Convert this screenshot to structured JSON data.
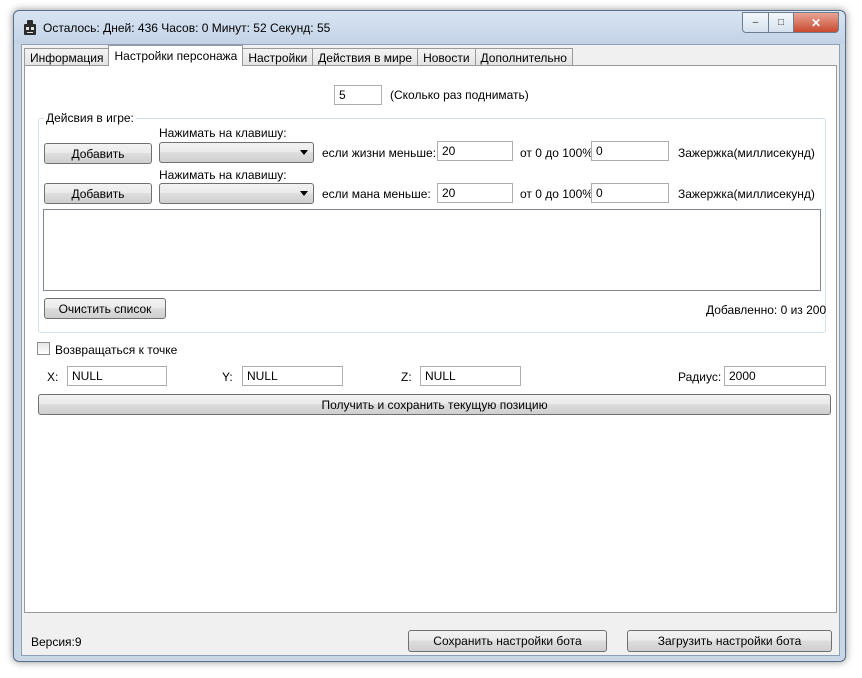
{
  "window": {
    "title": "Осталось: Дней: 436 Часов: 0 Минут: 52 Секунд: 55",
    "close_glyph": "✕",
    "max_glyph": "□",
    "min_glyph": "–"
  },
  "tabs": [
    {
      "label": "Информация"
    },
    {
      "label": "Настройки персонажа"
    },
    {
      "label": "Настройки"
    },
    {
      "label": "Действия в мире"
    },
    {
      "label": "Новости"
    },
    {
      "label": "Дополнительно"
    }
  ],
  "pickup": {
    "count_value": "5",
    "count_hint": "(Сколько раз поднимать)"
  },
  "actions_group": {
    "title": "Дейсвия в игре:",
    "rows": [
      {
        "add_label": "Добавить",
        "key_label": "Нажимать на клавишу:",
        "key_value": "",
        "condition_label": "если жизни меньше:",
        "threshold_value": "20",
        "range_label": "от 0 до 100%",
        "delay_value": "0",
        "delay_label": "Зажержка(миллисекунд)"
      },
      {
        "add_label": "Добавить",
        "key_label": "Нажимать на клавишу:",
        "key_value": "",
        "condition_label": "если мана меньше:",
        "threshold_value": "20",
        "range_label": "от 0 до 100%",
        "delay_value": "0",
        "delay_label": "Зажержка(миллисекунд)"
      }
    ],
    "clear_label": "Очистить список",
    "added_status": "Добавленно: 0 из 200"
  },
  "return_point": {
    "checkbox_label": "Возвращаться к точке",
    "checked": false,
    "x_label": "X:",
    "x_value": "NULL",
    "y_label": "Y:",
    "y_value": "NULL",
    "z_label": "Z:",
    "z_value": "NULL",
    "radius_label": "Радиус:",
    "radius_value": "2000",
    "get_position_label": "Получить и сохранить текущую позицию"
  },
  "footer": {
    "version": "Версия:9",
    "save_label": "Сохранить настройки бота",
    "load_label": "Загрузить настройки бота"
  }
}
